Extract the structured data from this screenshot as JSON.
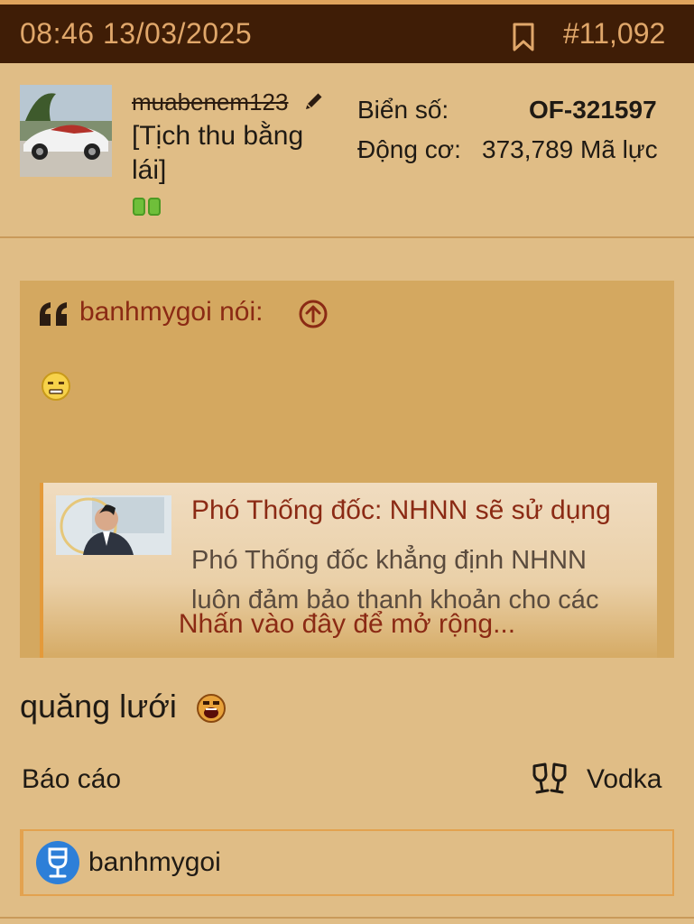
{
  "topbar": {
    "datetime": "08:46 13/03/2025",
    "post_number": "#11,092"
  },
  "user": {
    "username": "muabenem123",
    "title": "[Tịch thu bằng lái]",
    "plate_label": "Biển số:",
    "plate_value": "OF-321597",
    "engine_label": "Động cơ:",
    "engine_value": "373,789 Mã lực"
  },
  "quote": {
    "author": "banhmygoi nói:",
    "embed_title": "Phó Thống đốc: NHNN sẽ sử dụng",
    "embed_desc": "Phó Thống đốc khẳng định NHNN luôn đảm bảo thanh khoản cho các",
    "expand_label": "Nhấn vào đây để mở rộng..."
  },
  "message": {
    "text": "quăng lưới"
  },
  "actions": {
    "report": "Báo cáo",
    "react": "Vodka"
  },
  "reactions": {
    "user": "banhmygoi"
  },
  "colors": {
    "background": "#e0bd86",
    "topbar": "#3f1d06",
    "accent": "#8b2a14",
    "quote_bg": "#d4a860",
    "badge": "#2d7fd8"
  },
  "icons": [
    "bookmark-icon",
    "pencil-icon",
    "quote-icon",
    "arrow-up-circle-icon",
    "emoji-icon",
    "cheers-icon",
    "wine-glass-icon"
  ]
}
